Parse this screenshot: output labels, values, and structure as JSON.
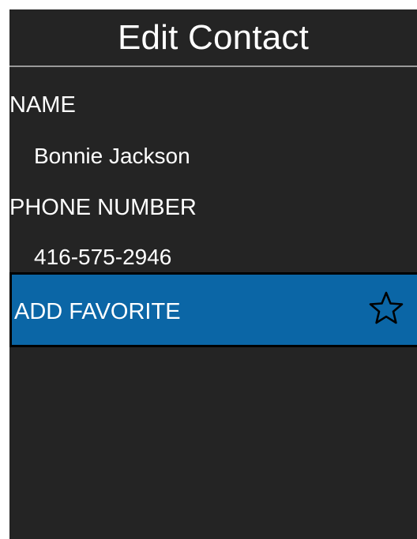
{
  "header": {
    "title": "Edit Contact"
  },
  "contact": {
    "name_label": "NAME",
    "name_value": "Bonnie Jackson",
    "phone_label": "PHONE NUMBER",
    "phone_value": "416-575-2946"
  },
  "favorite": {
    "label": "ADD FAVORITE",
    "icon": "star-outline-icon",
    "accent_color": "#0b66a6"
  }
}
